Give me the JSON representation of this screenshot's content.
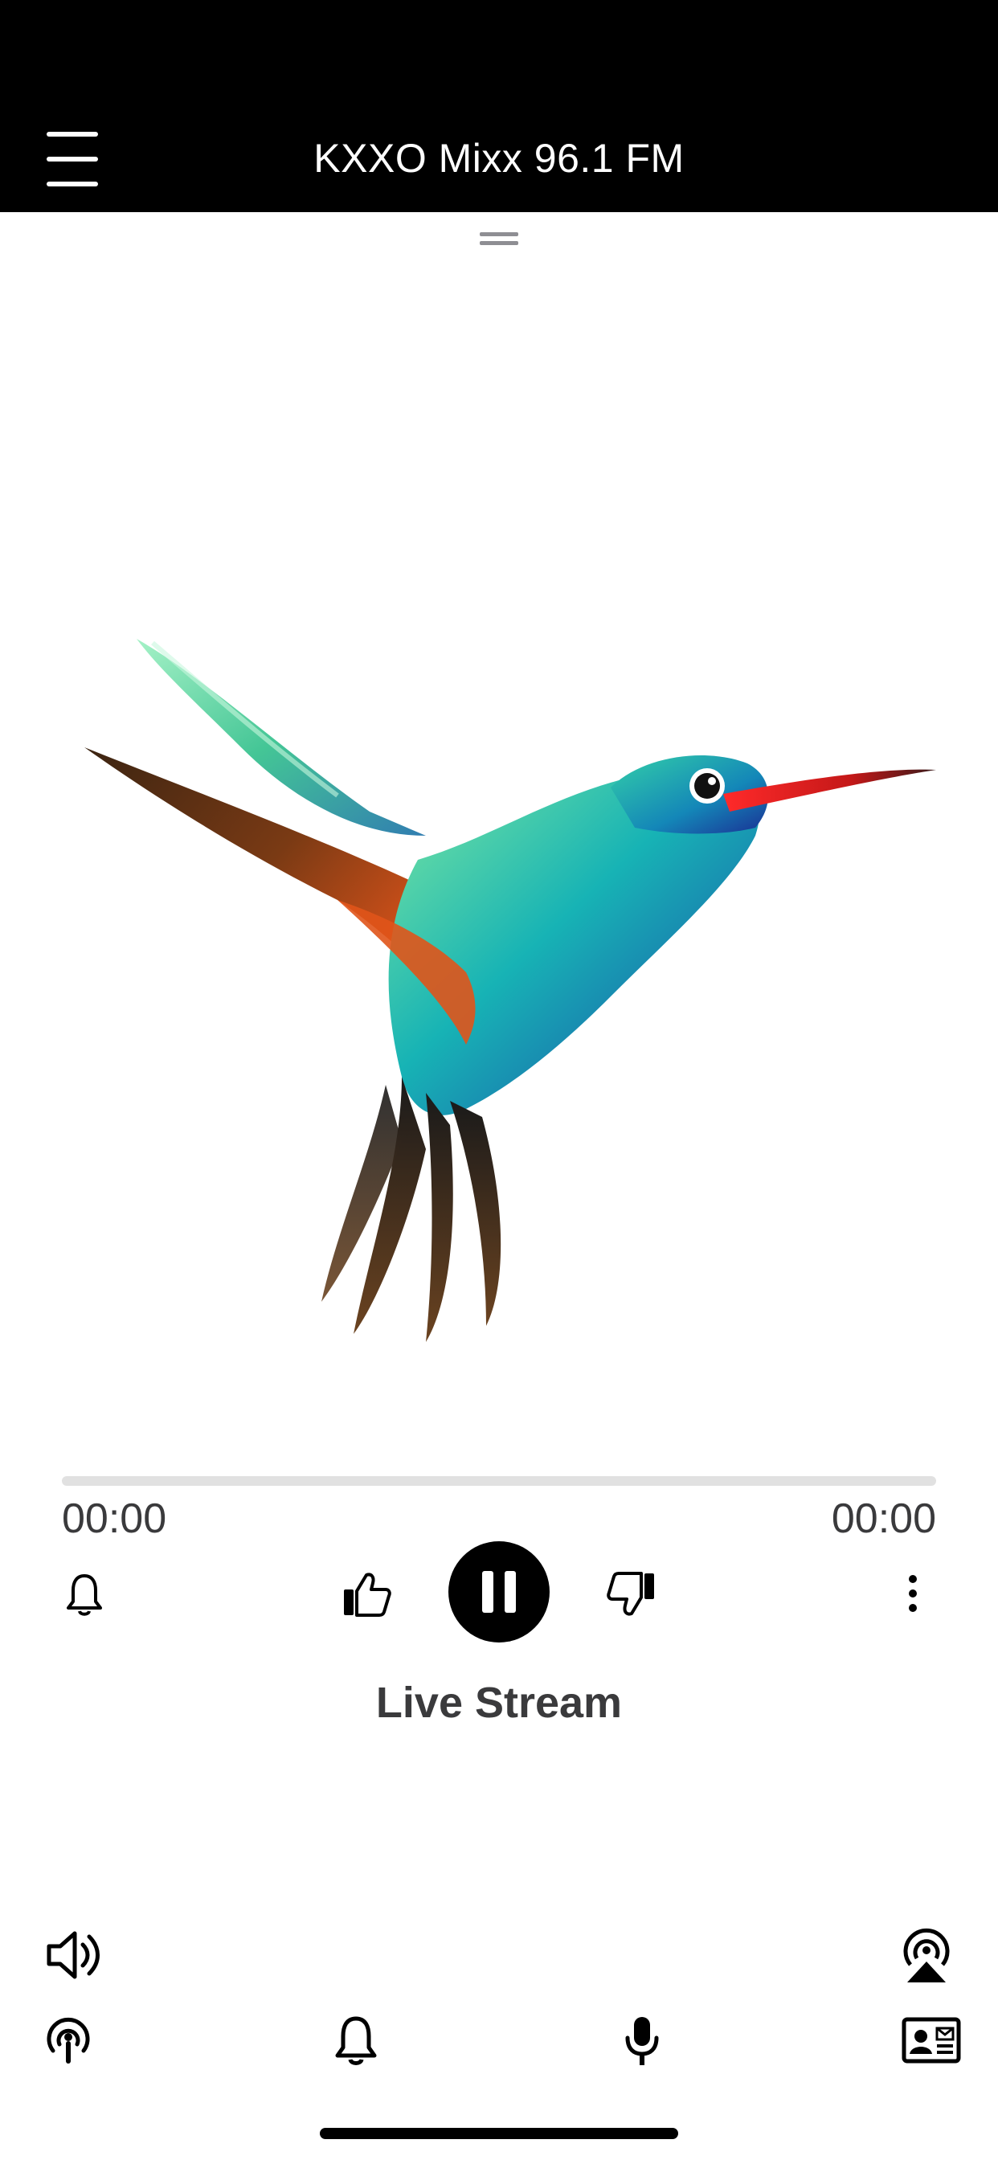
{
  "header": {
    "title": "KXXO Mixx 96.1 FM",
    "menu_icon": "hamburger-menu-icon"
  },
  "player": {
    "artwork_subject": "hummingbird",
    "progress": 0,
    "elapsed": "00:00",
    "duration": "00:00",
    "state": "playing",
    "stream_label": "Live Stream",
    "controls": {
      "alarm_icon": "bell-icon",
      "like_icon": "thumbs-up-icon",
      "toggle_icon": "pause-icon",
      "dislike_icon": "thumbs-down-icon",
      "more_icon": "vertical-ellipsis-icon"
    }
  },
  "footer": {
    "volume_icon": "speaker-volume-icon",
    "airplay_icon": "airplay-icon",
    "tabs": [
      {
        "icon": "podcast-broadcast-icon"
      },
      {
        "icon": "bell-icon"
      },
      {
        "icon": "microphone-icon"
      },
      {
        "icon": "contact-card-icon"
      }
    ]
  },
  "colors": {
    "header_background": "#000000",
    "text_secondary": "#3a3a3c",
    "progress_track": "#e1e1e1",
    "bill": "#e21b1b",
    "body_teal": "#1aa6b7",
    "wing_orange": "#d4501c"
  }
}
